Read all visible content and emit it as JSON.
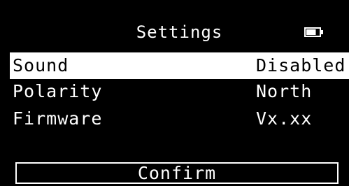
{
  "header": {
    "title": "Settings",
    "battery_icon": "battery-icon",
    "battery_level": 0.75
  },
  "settings": [
    {
      "label": "Sound",
      "value": "Disabled",
      "selected": true
    },
    {
      "label": "Polarity",
      "value": "North",
      "selected": false
    },
    {
      "label": "Firmware",
      "value": "Vx.xx",
      "selected": false
    }
  ],
  "confirm_label": "Confirm",
  "colors": {
    "background": "#000000",
    "foreground": "#ffffff",
    "highlight": "#ffffff"
  }
}
